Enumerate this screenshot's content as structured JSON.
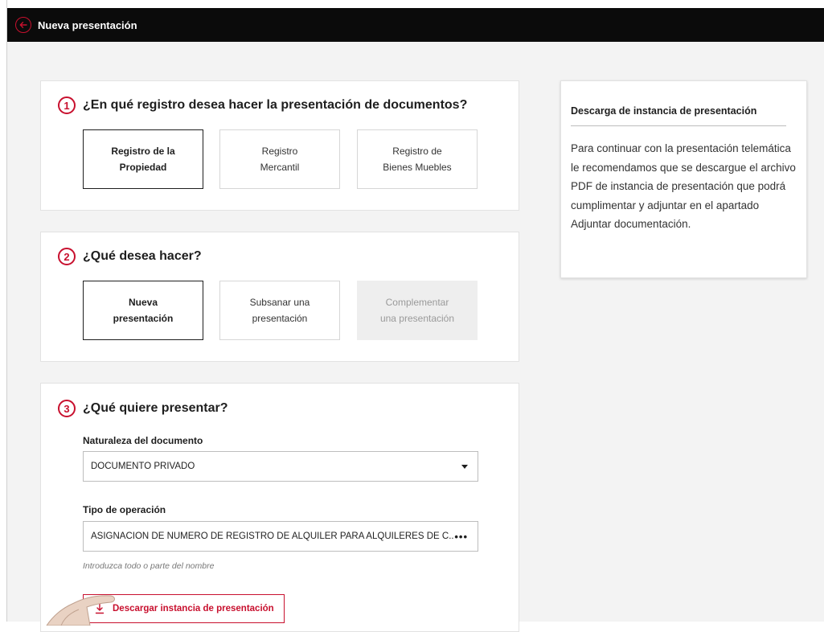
{
  "topbar": {
    "back_icon": "arrow-left-circle-icon",
    "title": "Nueva presentación"
  },
  "colors": {
    "accent": "#c8102e",
    "topbar_bg": "#0b0b0b",
    "page_bg": "#f3f3f3",
    "disabled_bg": "#eeeeee"
  },
  "step1": {
    "number": "1",
    "title": "¿En qué registro desea hacer la presentación de documentos?",
    "options": [
      {
        "label": "Registro de la\nPropiedad",
        "state": "selected"
      },
      {
        "label": "Registro\nMercantil",
        "state": "default"
      },
      {
        "label": "Registro de\nBienes Muebles",
        "state": "default"
      }
    ]
  },
  "step2": {
    "number": "2",
    "title": "¿Qué desea hacer?",
    "options": [
      {
        "label": "Nueva\npresentación",
        "state": "selected"
      },
      {
        "label": "Subsanar una\npresentación",
        "state": "default"
      },
      {
        "label": "Complementar\nuna presentación",
        "state": "disabled"
      }
    ]
  },
  "step3": {
    "number": "3",
    "title": "¿Qué quiere presentar?",
    "naturaleza": {
      "label": "Naturaleza del documento",
      "value": "DOCUMENTO PRIVADO",
      "icon": "caret-down-icon"
    },
    "tipo": {
      "label": "Tipo de operación",
      "value": "ASIGNACIÓN DE NÚMERO DE REGISTRO DE ALQUILER PARA ALQUILERES DE C...",
      "icon": "more-dots-icon",
      "hint": "Introduzca todo o parte del nombre"
    },
    "download_button": {
      "label": "Descargar instancia de presentación",
      "icon": "download-icon"
    }
  },
  "sidebar": {
    "title": "Descarga de instancia de presentación",
    "body": "Para continuar con la presentación telemática le recomendamos que se descargue el archivo PDF de instancia de presentación que podrá cumplimentar y adjuntar en el apartado Adjuntar documentación."
  }
}
